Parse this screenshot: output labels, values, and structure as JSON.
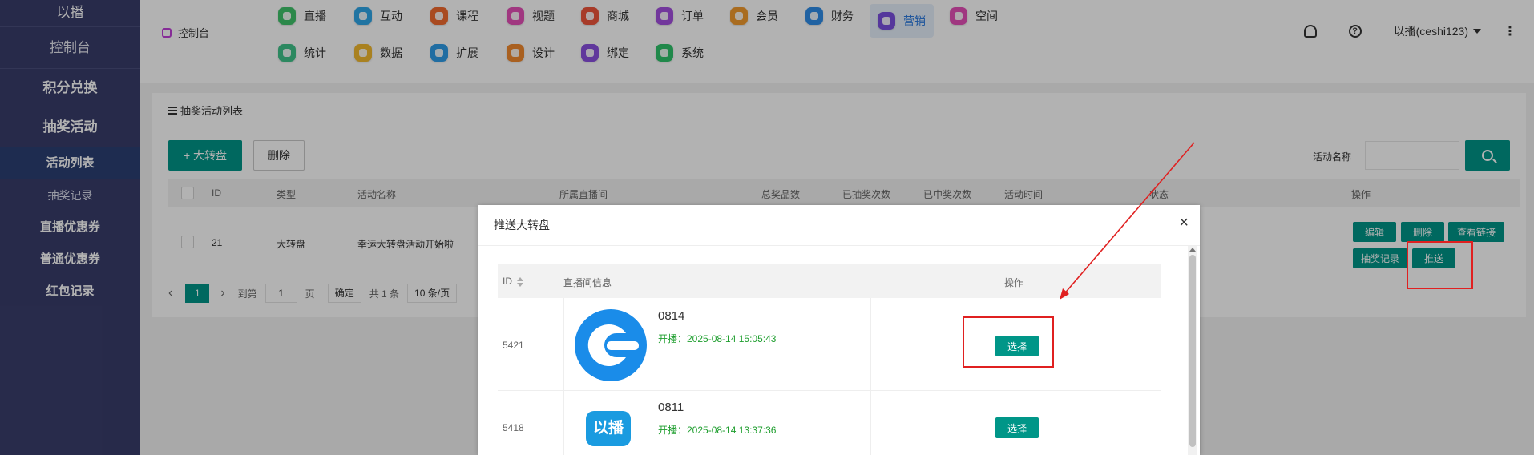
{
  "sidebar": {
    "brand": "以播",
    "console": "控制台",
    "groups": [
      "积分兑换",
      "抽奖活动"
    ],
    "items": [
      "活动列表",
      "抽奖记录",
      "直播优惠券",
      "普通优惠券",
      "红包记录"
    ]
  },
  "topnav": {
    "console_label": "控制台",
    "row1": [
      {
        "label": "直播",
        "color": "#3fc36b"
      },
      {
        "label": "互动",
        "color": "#2fa6e8"
      },
      {
        "label": "课程",
        "color": "#f26a2e"
      },
      {
        "label": "视题",
        "color": "#e64fb8"
      },
      {
        "label": "商城",
        "color": "#f0553c"
      },
      {
        "label": "订单",
        "color": "#a44fe0"
      },
      {
        "label": "会员",
        "color": "#f29b2e"
      },
      {
        "label": "财务",
        "color": "#2f8de8"
      },
      {
        "label": "营销",
        "color": "#7a4fe0"
      },
      {
        "label": "空间",
        "color": "#e64fb8"
      }
    ],
    "row2": [
      {
        "label": "统计",
        "color": "#3fc38a"
      },
      {
        "label": "数据",
        "color": "#f2b92e"
      },
      {
        "label": "扩展",
        "color": "#2f9de8"
      },
      {
        "label": "设计",
        "color": "#f28a2e"
      },
      {
        "label": "绑定",
        "color": "#8a4fe0"
      },
      {
        "label": "系统",
        "color": "#2fc36b"
      }
    ],
    "help_glyph": "?",
    "user": "以播(ceshi123)",
    "more": "⋮"
  },
  "list_page": {
    "title": "抽奖活动列表",
    "add_button": "+ 大转盘",
    "delete_button": "删除",
    "filter_label": "活动名称",
    "columns": [
      "ID",
      "类型",
      "活动名称",
      "所属直播间",
      "总奖品数",
      "已抽奖次数",
      "已中奖次数",
      "活动时间",
      "状态",
      "操作"
    ],
    "row": {
      "id": "21",
      "type": "大转盘",
      "name": "幸运大转盘活动开始啦"
    },
    "row_actions": [
      "编辑",
      "删除",
      "查看链接",
      "抽奖记录",
      "推送"
    ],
    "pager": {
      "prev": "‹",
      "current": "1",
      "next": "›",
      "goto": "到第",
      "goto_value": "1",
      "page_unit": "页",
      "confirm": "确定",
      "total": "共 1 条",
      "page_size": "10 条/页"
    }
  },
  "modal": {
    "title": "推送大转盘",
    "close": "×",
    "columns": [
      "ID",
      "直播间信息",
      "操作"
    ],
    "rows": [
      {
        "id": "5421",
        "name": "0814",
        "time": "开播：2025-08-14 15:05:43",
        "action": "选择"
      },
      {
        "id": "5418",
        "name": "0811",
        "time": "开播：2025-08-14 13:37:36",
        "action": "选择",
        "logo_text": "以播"
      }
    ]
  },
  "colors": {
    "sidebar": "#393d6b",
    "primary": "#009688",
    "annotation": "#e02020"
  }
}
